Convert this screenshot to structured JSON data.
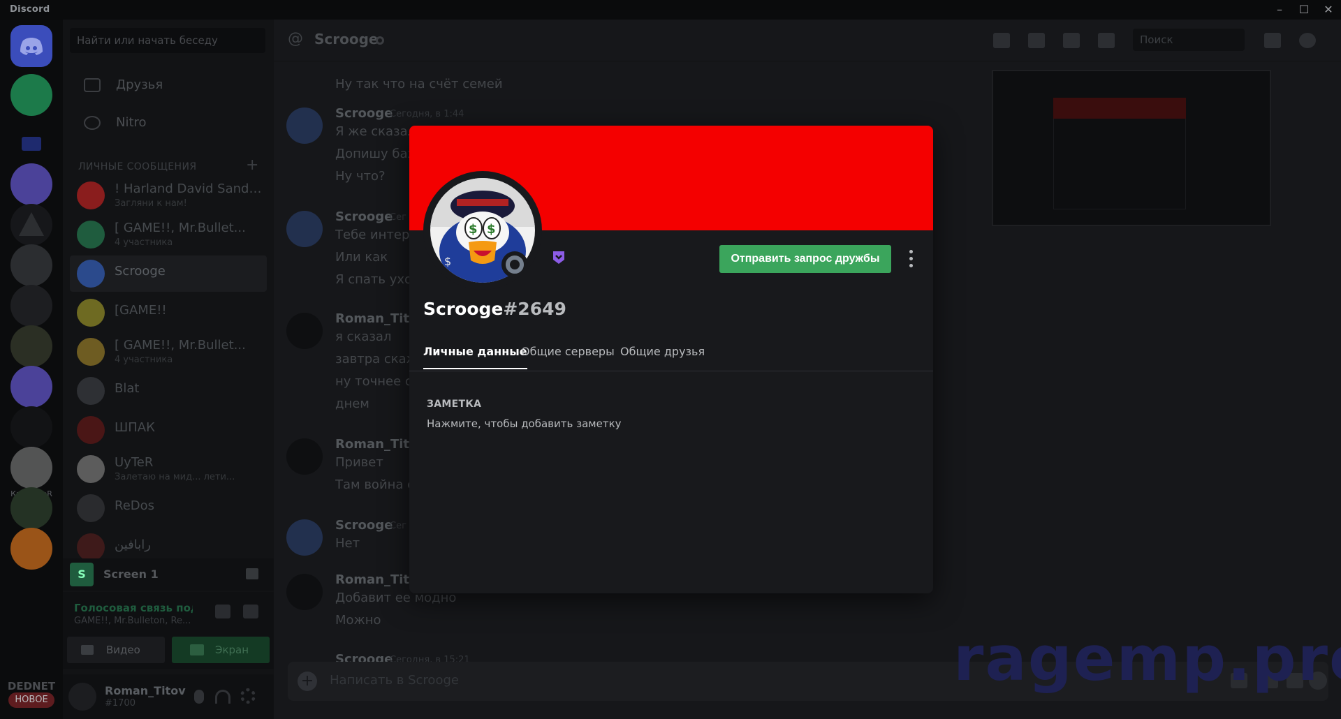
{
  "window": {
    "title": "Discord",
    "controls": [
      "–",
      "☐",
      "✕"
    ]
  },
  "rail": {
    "servers": [
      {
        "name": "discord-home",
        "color": "#3a4ec0"
      },
      {
        "name": "friends-group",
        "color": "#1c7a4a"
      },
      {
        "name": "folder",
        "color": "#1e2a6e"
      },
      {
        "name": "E-server-1",
        "color": "#5a4fb0"
      },
      {
        "name": "A-server",
        "color": "#1a1b1e"
      },
      {
        "name": "FIB",
        "color": "#2b2d30"
      },
      {
        "name": "bank",
        "color": "#2a2b2e"
      },
      {
        "name": "badge-server",
        "color": "#2b2f24"
      },
      {
        "name": "E-server-2",
        "color": "#5a4fb0"
      },
      {
        "name": "kakoy-to-r",
        "color": "#141517"
      },
      {
        "name": "white-server",
        "color": "#c8c8c8"
      },
      {
        "name": "R-server",
        "color": "#2a3a2a"
      },
      {
        "name": "Q-server",
        "color": "#c56a1e"
      }
    ],
    "kakoy_label": "Какой-тоR",
    "dednet_label": "DEDNET",
    "new_badge": "НОВОЕ"
  },
  "dm_sidebar": {
    "search_placeholder": "Найти или начать беседу",
    "nav": [
      {
        "label": "Друзья",
        "icon": "friends-icon"
      },
      {
        "label": "Nitro",
        "icon": "nitro-icon"
      }
    ],
    "section_header": "ЛИЧНЫЕ СООБЩЕНИЯ",
    "dms": [
      {
        "name": "! Harland David Sanders",
        "sub": "Загляни к нам!",
        "color": "#8a1d1d"
      },
      {
        "name": "[ GAME!!, Mr.Bullet...",
        "sub": "4 участника",
        "color": "#2d7d54"
      },
      {
        "name": "Scrooge",
        "sub": "",
        "color": "#2b4a8c",
        "active": true
      },
      {
        "name": "[GAME!!",
        "sub": "",
        "color": "#c4b82a"
      },
      {
        "name": "[ GAME!!, Mr.Bullet...",
        "sub": "4 участника",
        "color": "#c4a02a"
      },
      {
        "name": "Blat",
        "sub": "",
        "color": "#4a4c50"
      },
      {
        "name": "ШПАК",
        "sub": "",
        "color": "#6a1a1a"
      },
      {
        "name": "UyTeR",
        "sub": "Залетаю на мид... лети...",
        "color": "#8c8c8c"
      },
      {
        "name": "ReDos",
        "sub": "",
        "color": "#3c3e42"
      },
      {
        "name": "رابافين",
        "sub": "",
        "color": "#5a2323"
      }
    ],
    "stream": {
      "label": "Screen 1",
      "initial": "S"
    },
    "voice": {
      "status": "Голосовая связь подк",
      "channel": "GAME!!, Mr.Bulleton, Re...",
      "video_label": "Видео",
      "screen_label": "Экран"
    },
    "user": {
      "name": "Roman_Titov",
      "tag": "#1700"
    }
  },
  "chat": {
    "channel_name": "Scrooge",
    "search_placeholder": "Поиск",
    "composer_placeholder": "Написать в Scrooge",
    "messages": [
      {
        "author": "",
        "time": "",
        "lines": [
          "Ну так что на счёт семей"
        ]
      },
      {
        "author": "Scrooge",
        "time": "Сегодня, в 1:44",
        "lines": [
          "Я же сказал",
          "Допишу баз",
          "Ну что?"
        ]
      },
      {
        "author": "Scrooge",
        "time": "Сег",
        "lines": [
          "Тебе интере",
          "Или как",
          "Я спать ухож"
        ]
      },
      {
        "author": "Roman_Titov",
        "time": "",
        "lines": [
          "я сказал",
          "завтра скаж",
          "ну точнее се",
          "днем"
        ]
      },
      {
        "author": "Roman_Titov",
        "time": "",
        "lines": [
          "Привет",
          "Там война с"
        ]
      },
      {
        "author": "Scrooge",
        "time": "Сег",
        "lines": [
          "Нет"
        ]
      },
      {
        "author": "Roman_Titov",
        "time": "",
        "lines": [
          "Добавит ее модно",
          "Можно"
        ]
      },
      {
        "author": "Scrooge",
        "time": "Сегодня, в 15:21",
        "lines": []
      }
    ]
  },
  "watermark": "ragemp.pro",
  "profile_modal": {
    "banner_color": "#f40000",
    "username": "Scrooge",
    "discriminator": "#2649",
    "add_friend_button": "Отправить запрос дружбы",
    "tabs": [
      "Личные данные",
      "Общие серверы",
      "Общие друзья"
    ],
    "active_tab": 0,
    "note_header": "ЗАМЕТКА",
    "note_placeholder": "Нажмите, чтобы добавить заметку",
    "status": "offline"
  }
}
